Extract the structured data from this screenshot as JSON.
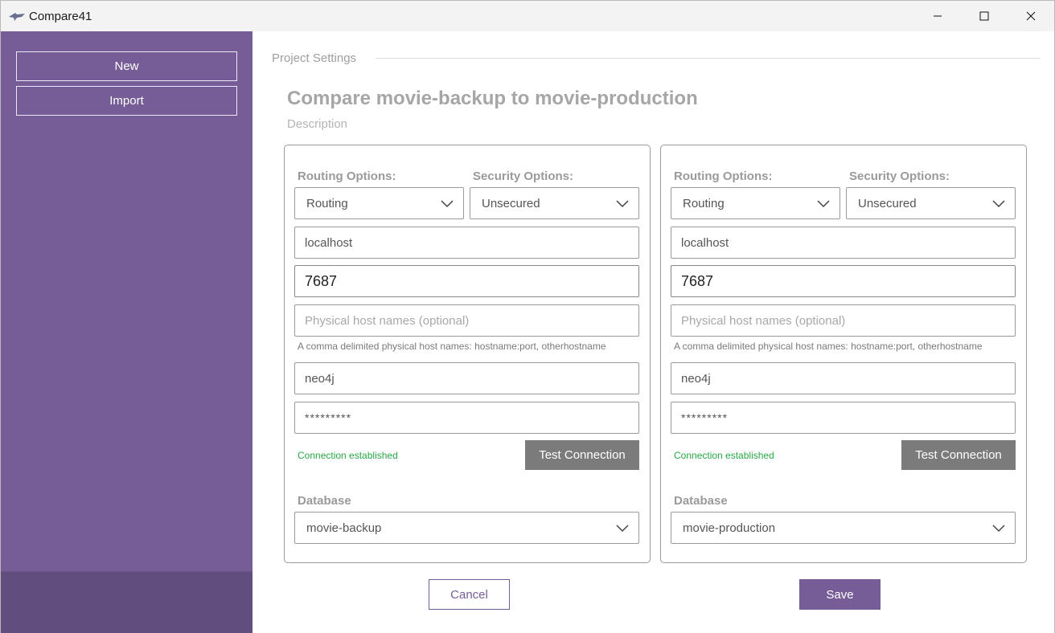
{
  "window": {
    "title": "Compare41",
    "icons": {
      "app": "app-logo-icon",
      "minimize": "minimize-icon",
      "maximize": "maximize-icon",
      "close": "close-icon"
    }
  },
  "sidebar": {
    "new_label": "New",
    "import_label": "Import"
  },
  "main": {
    "section_label": "Project Settings",
    "project_title": "Compare movie-backup to movie-production",
    "description_placeholder": "Description",
    "panels": [
      {
        "routing_label": "Routing Options:",
        "routing_value": "Routing",
        "security_label": "Security Options:",
        "security_value": "Unsecured",
        "host": "localhost",
        "port": "7687",
        "physical_hosts_placeholder": "Physical host names (optional)",
        "physical_hosts_help": "A comma delimited physical host names: hostname:port, otherhostname",
        "username": "neo4j",
        "password": "*********",
        "status": "Connection established",
        "test_label": "Test Connection",
        "database_label": "Database",
        "database_value": "movie-backup"
      },
      {
        "routing_label": "Routing Options:",
        "routing_value": "Routing",
        "security_label": "Security Options:",
        "security_value": "Unsecured",
        "host": "localhost",
        "port": "7687",
        "physical_hosts_placeholder": "Physical host names (optional)",
        "physical_hosts_help": "A comma delimited physical host names: hostname:port, otherhostname",
        "username": "neo4j",
        "password": "*********",
        "status": "Connection established",
        "test_label": "Test Connection",
        "database_label": "Database",
        "database_value": "movie-production"
      }
    ],
    "cancel_label": "Cancel",
    "save_label": "Save"
  },
  "colors": {
    "accent": "#775d97",
    "sidebar_footer": "#624d7f",
    "success": "#28a745",
    "test_button": "#7b7b7b"
  }
}
